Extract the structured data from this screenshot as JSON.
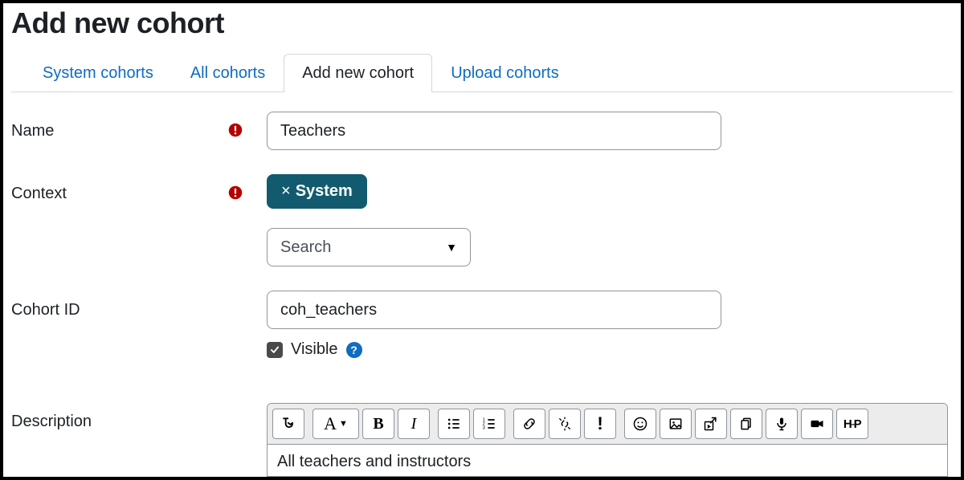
{
  "page": {
    "title": "Add new cohort"
  },
  "tabs": {
    "system": "System cohorts",
    "all": "All cohorts",
    "add": "Add new cohort",
    "upload": "Upload cohorts"
  },
  "labels": {
    "name": "Name",
    "context": "Context",
    "cohort_id": "Cohort ID",
    "description": "Description",
    "visible": "Visible"
  },
  "values": {
    "name": "Teachers",
    "context_chip": "System",
    "search_placeholder": "Search",
    "cohort_id": "coh_teachers",
    "visible_checked": true,
    "description": "All teachers and instructors"
  }
}
